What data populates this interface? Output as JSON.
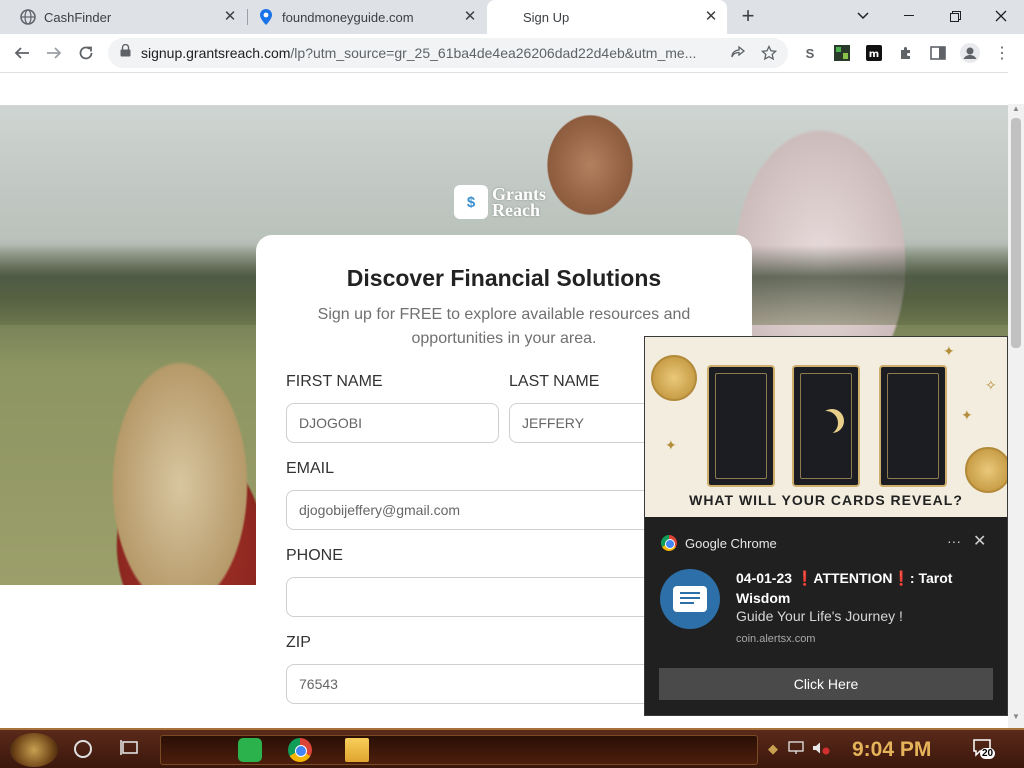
{
  "browser": {
    "tabs": [
      {
        "title": "CashFinder",
        "icon": "globe-icon"
      },
      {
        "title": "foundmoneyguide.com",
        "icon": "location-pin-icon"
      },
      {
        "title": "Sign Up",
        "icon": "none"
      }
    ],
    "active_tab": 2,
    "url_host": "signup.grantsreach.com",
    "url_path": "/lp?utm_source=gr_25_61ba4de4ea26206dad22d4eb&utm_me..."
  },
  "page": {
    "logo_text_line1": "Grants",
    "logo_text_line2": "Reach",
    "logo_mark": "$",
    "heading": "Discover Financial Solutions",
    "subheading": "Sign up for FREE to explore available resources and opportunities in your area.",
    "form": {
      "first_name_label": "FIRST NAME",
      "first_name_value": "DJOGOBI",
      "last_name_label": "LAST NAME",
      "last_name_value": "JEFFERY",
      "email_label": "EMAIL",
      "email_value": "djogobijeffery@gmail.com",
      "phone_label": "PHONE",
      "phone_value": "",
      "zip_label": "ZIP",
      "zip_value": "76543"
    }
  },
  "notification": {
    "image_caption": "WHAT WILL YOUR CARDS REVEAL?",
    "app_name": "Google Chrome",
    "title_date": "04-01-23",
    "title_bang": "❗",
    "title_word": "ATTENTION",
    "title_rest": ": Tarot Wisdom",
    "body": "Guide Your Life's Journey !",
    "source": "coin.alertsx.com",
    "button_label": "Click Here"
  },
  "taskbar": {
    "clock": "9:04 PM",
    "notification_count": "20"
  }
}
